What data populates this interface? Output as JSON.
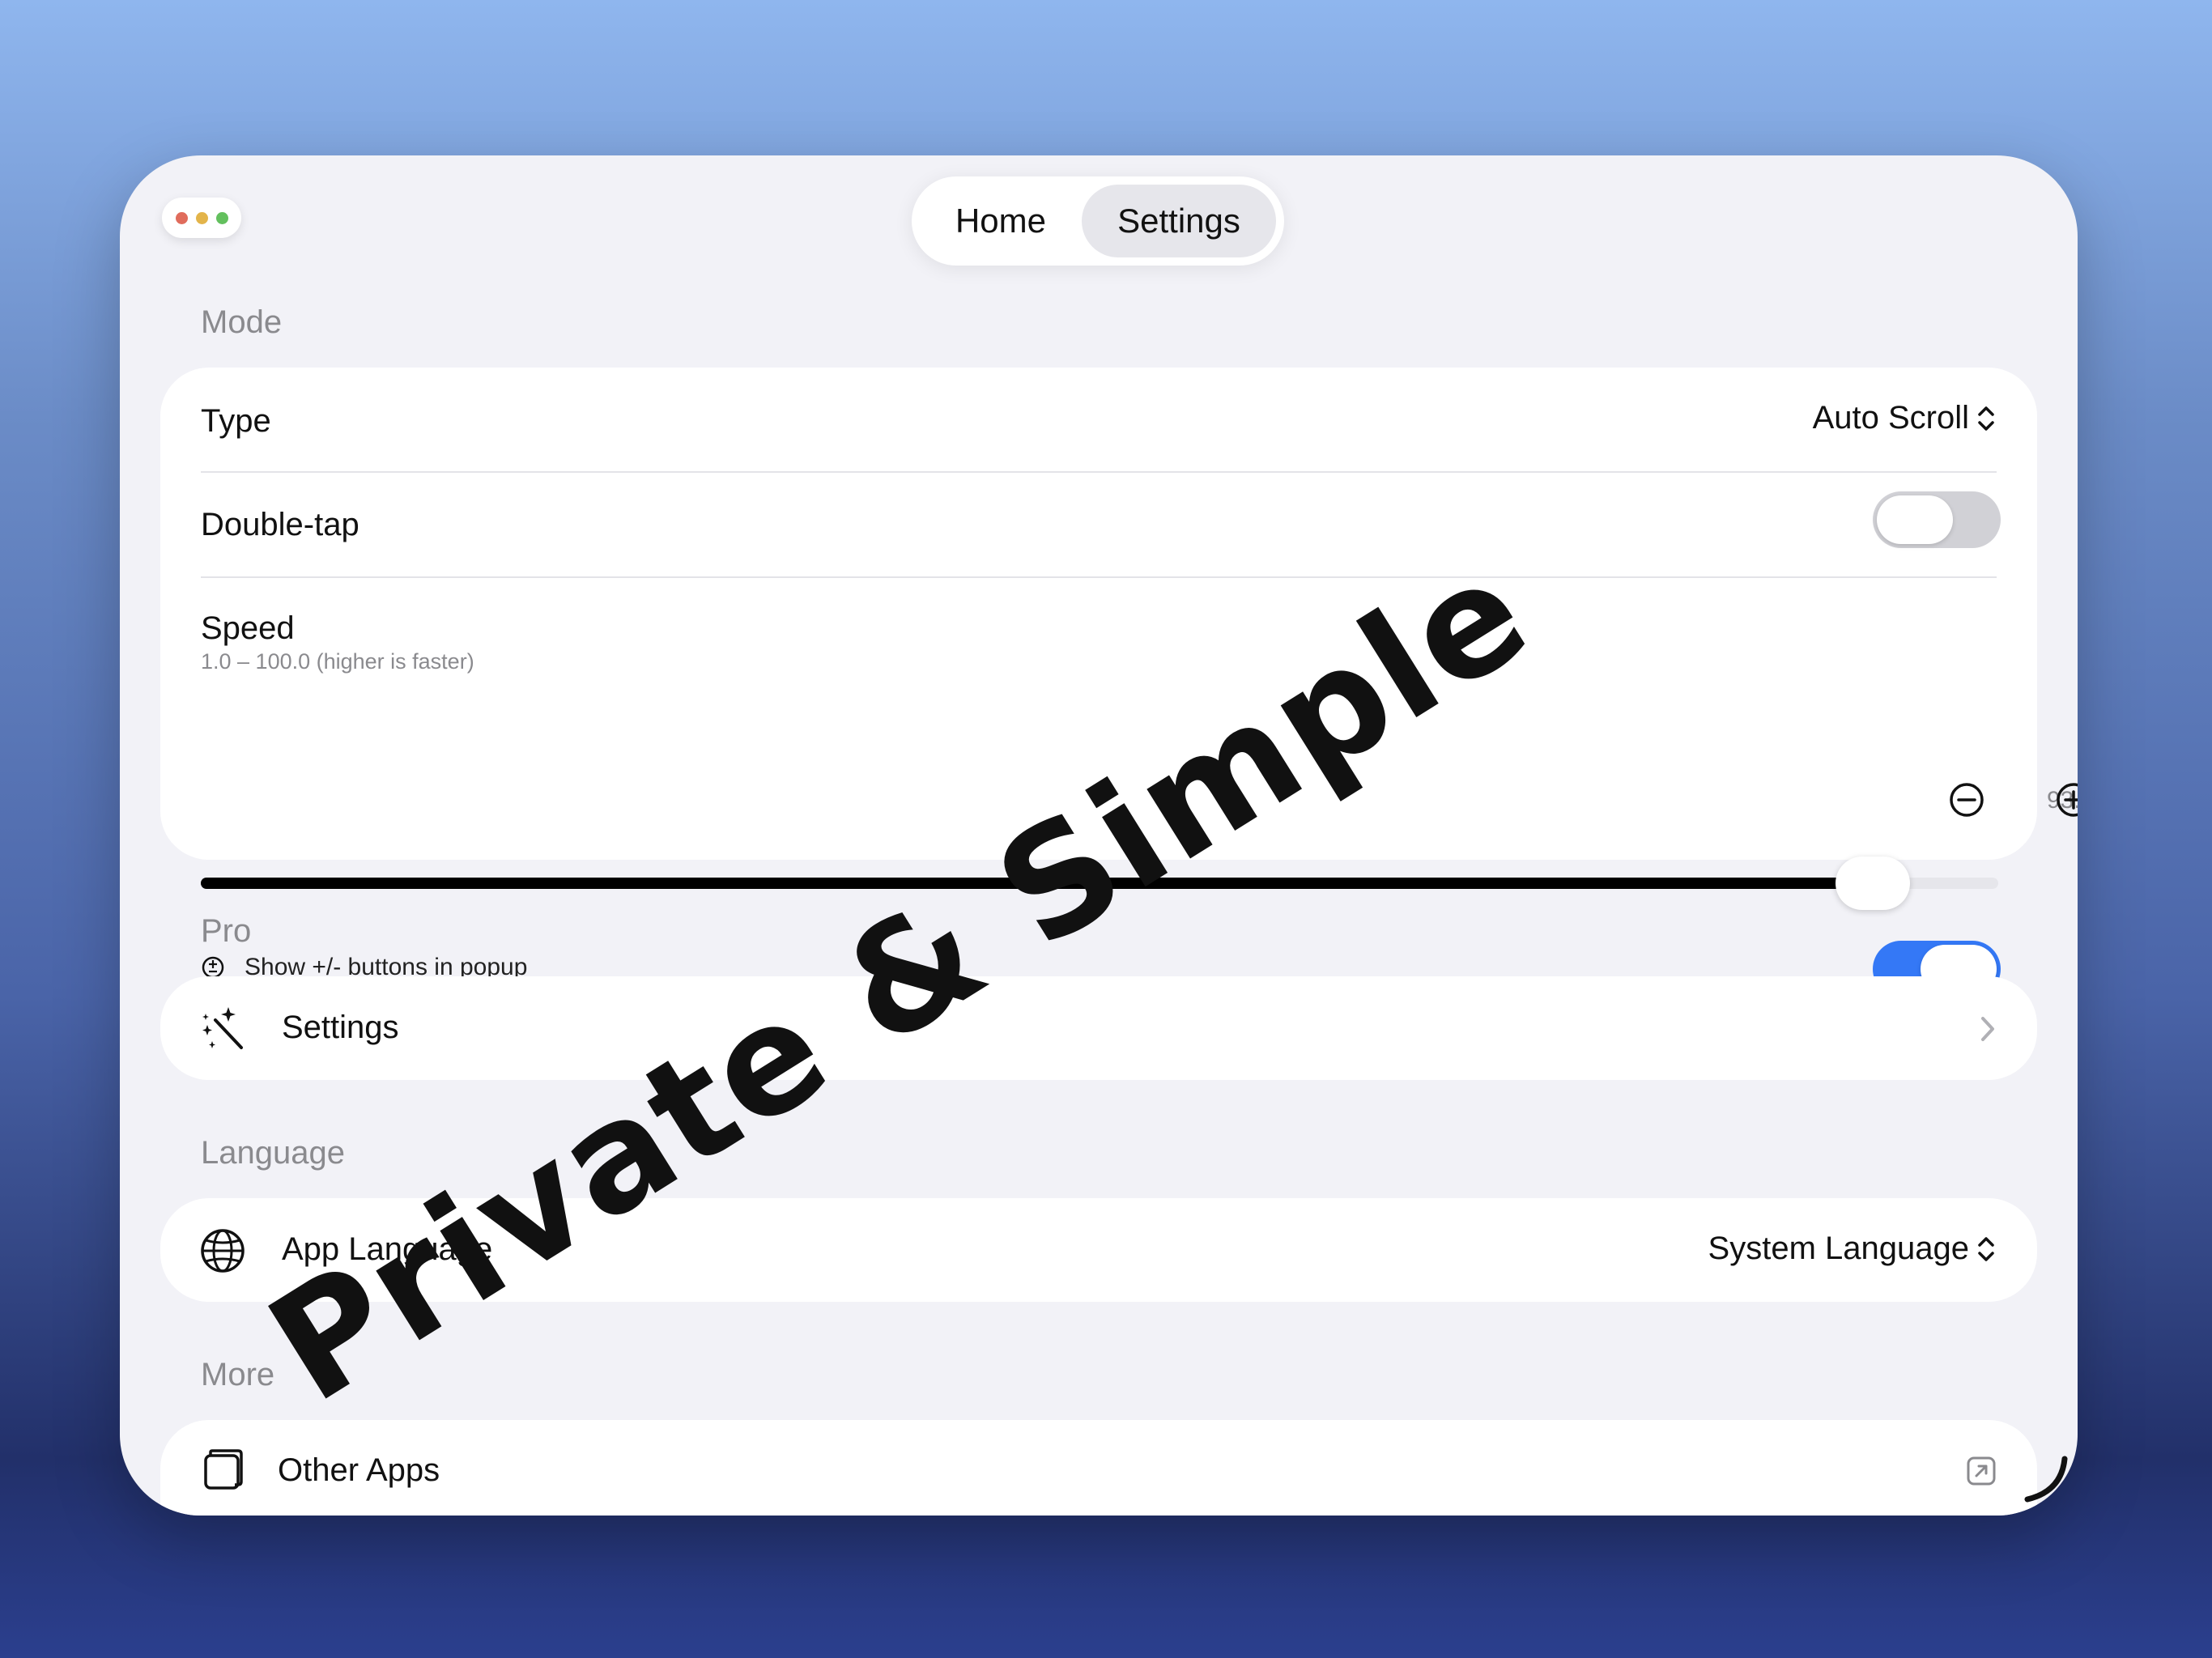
{
  "tabs": {
    "home": "Home",
    "settings": "Settings"
  },
  "mode": {
    "section": "Mode",
    "type_label": "Type",
    "type_value": "Auto Scroll",
    "double_tap_label": "Double-tap",
    "double_tap_on": false,
    "speed_label": "Speed",
    "speed_range": "1.0 – 100.0 (higher is faster)",
    "speed_value": "93.0",
    "speed_fraction": 0.93,
    "popup_buttons_label": "Show +/- buttons in popup",
    "popup_buttons_on": true
  },
  "pro": {
    "section": "Pro",
    "settings_label": "Settings"
  },
  "language": {
    "section": "Language",
    "app_language_label": "App Language",
    "app_language_value": "System Language"
  },
  "more": {
    "section": "More",
    "other_apps_label": "Other Apps"
  },
  "overlay_text": "Private & Simple",
  "colors": {
    "accent": "#3478f6",
    "toggle_off": "#d1d1d6",
    "background": "#f2f2f7"
  }
}
